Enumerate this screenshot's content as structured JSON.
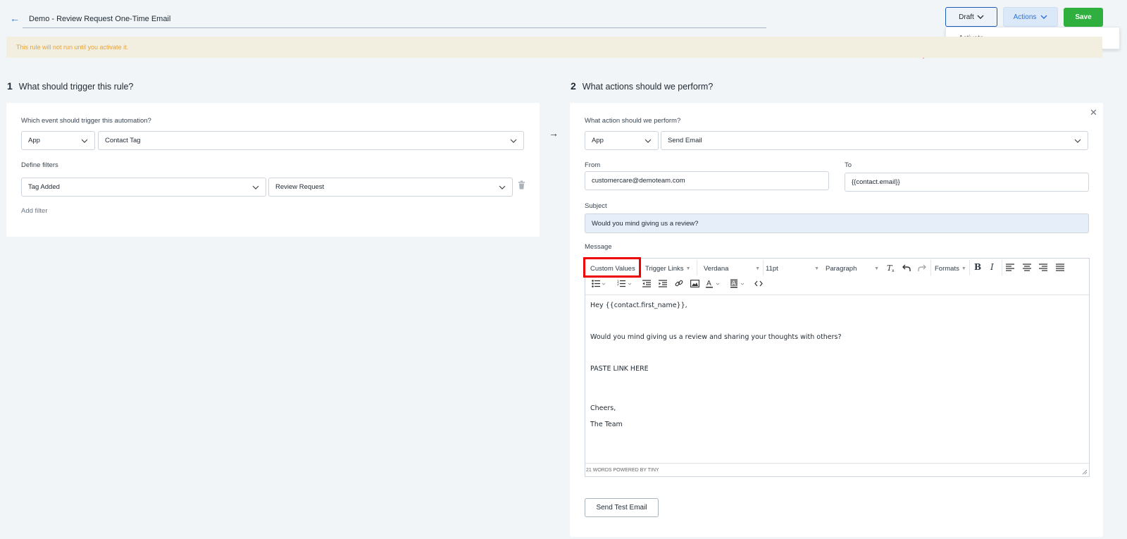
{
  "header": {
    "back_icon": "arrow-left-icon",
    "title": "Demo - Review Request One-Time Email",
    "draft_label": "Draft",
    "actions_label": "Actions",
    "save_label": "Save",
    "dropdown_items": [
      "Activate"
    ]
  },
  "notice": "This rule will not run until you activate it.",
  "trigger": {
    "step": "1",
    "heading": "What should trigger this rule?",
    "event_label": "Which event should trigger this automation?",
    "event_source": "App",
    "event_value": "Contact Tag",
    "filters_label": "Define filters",
    "filter_field": "Tag Added",
    "filter_value": "Review Request",
    "add_filter": "Add filter"
  },
  "action": {
    "step": "2",
    "heading": "What actions should we perform?",
    "action_label": "What action should we perform?",
    "action_source": "App",
    "action_value": "Send Email",
    "from_label": "From",
    "from_value": "customercare@demoteam.com",
    "to_label": "To",
    "to_value": "{{contact.email}}",
    "subject_label": "Subject",
    "subject_value": "Would you mind giving us a review?",
    "message_label": "Message",
    "send_test_label": "Send Test Email"
  },
  "editor": {
    "toolbar": {
      "custom_values": "Custom Values",
      "trigger_links": "Trigger Links",
      "font": "Verdana",
      "size": "11pt",
      "block": "Paragraph",
      "formats": "Formats"
    },
    "lines": [
      "Hey {{contact.first_name}},",
      "",
      "Would you mind giving us a review and sharing your thoughts with others?",
      "",
      "PASTE LINK HERE",
      "",
      "",
      "Cheers,",
      "The Team"
    ],
    "status": "21 WORDS POWERED BY TINY"
  },
  "colors": {
    "accent_blue": "#2b72d6",
    "save_green": "#2eaf3e",
    "notice_bg": "#f2eee0",
    "notice_text": "#e7a43a",
    "highlight_red": "#e00000"
  }
}
